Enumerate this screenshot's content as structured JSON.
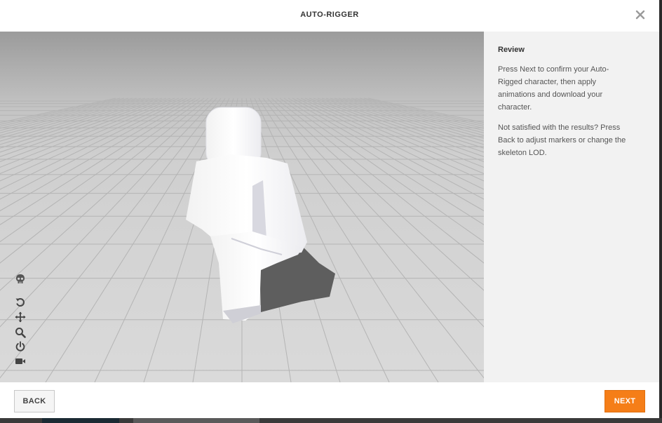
{
  "header": {
    "title": "AUTO-RIGGER",
    "close_icon": "close-icon"
  },
  "viewport": {
    "tools": [
      "skeleton-icon",
      "rotate-icon",
      "pan-icon",
      "zoom-icon",
      "power-icon",
      "camera-icon"
    ]
  },
  "panel": {
    "heading": "Review",
    "para1": "Press Next to confirm your Auto-Rigged character, then apply animations and download your character.",
    "para2": "Not satisfied with the results? Press Back to adjust markers or change the skeleton LOD."
  },
  "footer": {
    "back_label": "BACK",
    "next_label": "NEXT"
  },
  "colors": {
    "accent": "#f57e18",
    "panel_bg": "#f2f2f2"
  }
}
